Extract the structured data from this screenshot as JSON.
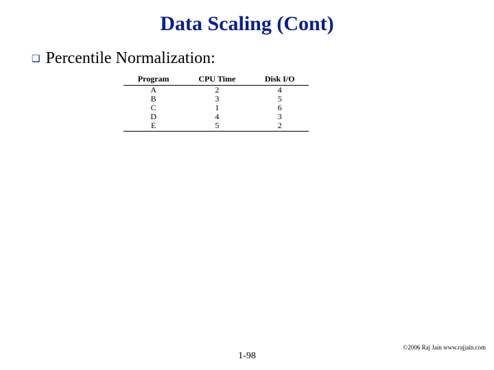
{
  "title": "Data Scaling (Cont)",
  "bullet": {
    "marker": "❑",
    "text": "Percentile Normalization:"
  },
  "chart_data": {
    "type": "table",
    "columns": [
      "Program",
      "CPU Time",
      "Disk I/O"
    ],
    "rows": [
      {
        "program": "A",
        "cpu": 2,
        "io": 4
      },
      {
        "program": "B",
        "cpu": 3,
        "io": 5
      },
      {
        "program": "C",
        "cpu": 1,
        "io": 6
      },
      {
        "program": "D",
        "cpu": 4,
        "io": 3
      },
      {
        "program": "E",
        "cpu": 5,
        "io": 2
      }
    ]
  },
  "footer": {
    "page": "1-98",
    "copyright": "©2006 Raj Jain www.rajjain.com"
  }
}
